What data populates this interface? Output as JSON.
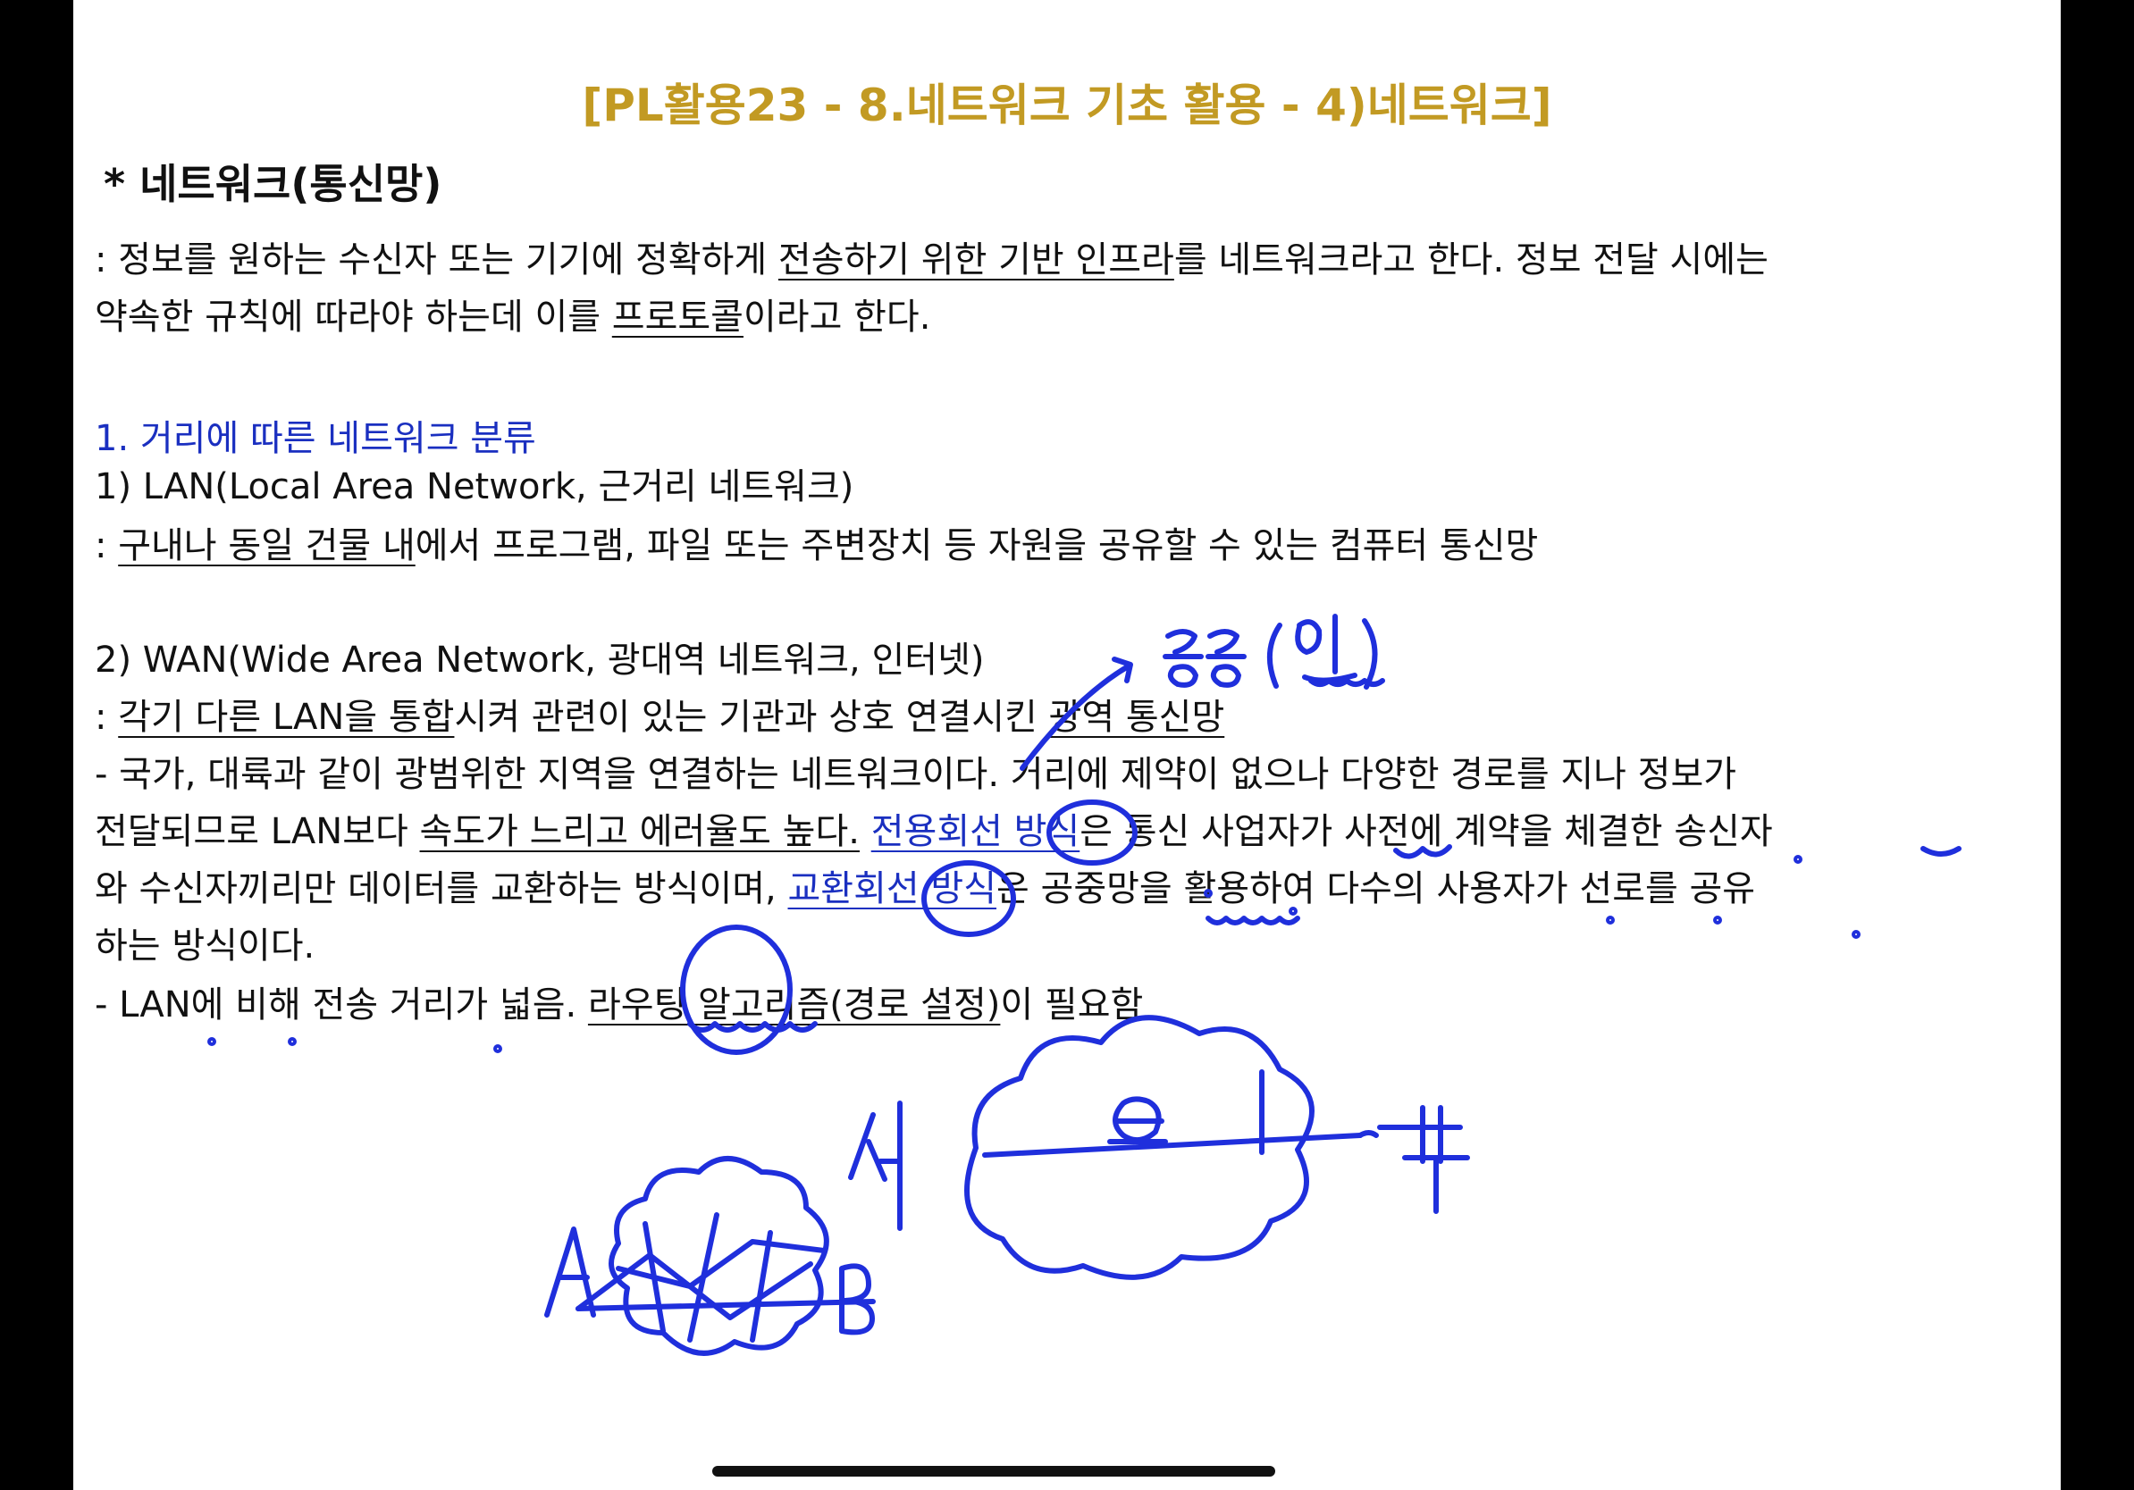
{
  "document": {
    "title": "[PL활용23 - 8.네트워크 기초 활용 - 4)네트워크]",
    "heading": "* 네트워크(통신망)",
    "intro": {
      "l1_a": ": 정보를 원하는 수신자 또는 기기에 정확하게 ",
      "l1_u": "전송하기 위한 기반 인프라",
      "l1_b": "를 네트워크라고 한다. 정보 전달 시에는",
      "l2_a": "약속한 규칙에 따라야 하는데 이를 ",
      "l2_u": "프로토콜",
      "l2_b": "이라고 한다."
    },
    "section1": "1. 거리에 따른 네트워크 분류",
    "lan": {
      "title": "1) LAN(Local Area Network, 근거리 네트워크)",
      "desc_prefix": ": ",
      "desc_u": "구내나 동일 건물 내",
      "desc_b": "에서 프로그램, 파일 또는 주변장치 등 자원을 공유할 수 있는 컴퓨터 통신망"
    },
    "wan": {
      "title": "2) WAN(Wide Area Network, 광대역 네트워크, 인터넷)",
      "desc_prefix": ": ",
      "desc_u1": "각기 다른 LAN을 통합",
      "desc_m": "시켜 관련이 있는 기관과 상호 연결시킨 ",
      "desc_u2": "광역 통신망",
      "b1_l1": "- 국가, 대륙과 같이 광범위한 지역을 연결하는 네트워크이다. 거리에 제약이 없으나 다양한 경로를 지나 정보가",
      "b1_l2_a": "전달되므로 LAN보다 ",
      "b1_l2_u": "속도가 느리고 에러율도 높다.",
      "b1_l2_s": " ",
      "b1_l2_link": "전용회선 방식",
      "b1_l2_b": "은 통신 사업자가 사전에 계약을 체결한 송신자",
      "b1_l3_a": "와 수신자끼리만 데이터를 교환하는 방식이며, ",
      "b1_l3_link": "교환회선 방식",
      "b1_l3_b": "은 공중망을 활용하여 다수의 사용자가 선로를 공유",
      "b1_l4": "하는 방식이다.",
      "b2_a": "- LAN에 비해 전송 거리가 넓음. ",
      "b2_u": "라우팅 알고리즘(경로 설정)",
      "b2_b": "이 필요함"
    }
  },
  "annotations": {
    "ink_color": "#1f2fdc"
  }
}
